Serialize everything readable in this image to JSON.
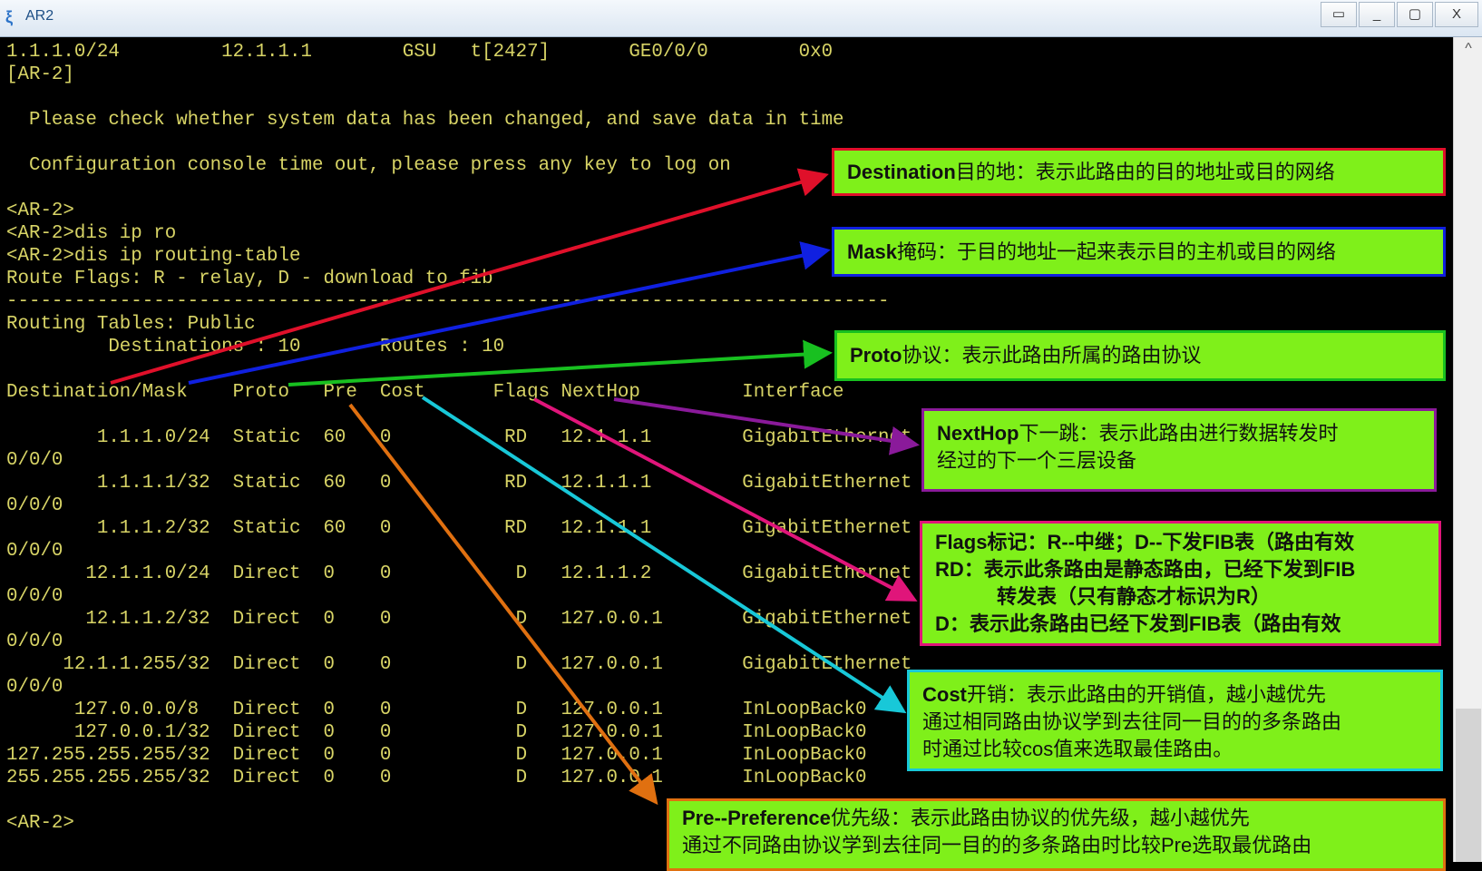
{
  "window": {
    "title": "AR2",
    "buttons": [
      "▭",
      "_",
      "▢",
      "X"
    ]
  },
  "terminal": {
    "lines": [
      "1.1.1.0/24         12.1.1.1        GSU   t[2427]       GE0/0/0        0x0",
      "[AR-2]",
      "",
      "  Please check whether system data has been changed, and save data in time",
      "",
      "  Configuration console time out, please press any key to log on",
      "",
      "<AR-2>",
      "<AR-2>dis ip ro",
      "<AR-2>dis ip routing-table",
      "Route Flags: R - relay, D - download to fib",
      "------------------------------------------------------------------------------",
      "Routing Tables: Public",
      "         Destinations : 10       Routes : 10",
      "",
      "Destination/Mask    Proto   Pre  Cost      Flags NextHop         Interface",
      "",
      "        1.1.1.0/24  Static  60   0          RD   12.1.1.1        GigabitEthernet",
      "0/0/0",
      "        1.1.1.1/32  Static  60   0          RD   12.1.1.1        GigabitEthernet",
      "0/0/0",
      "        1.1.1.2/32  Static  60   0          RD   12.1.1.1        GigabitEthernet",
      "0/0/0",
      "       12.1.1.0/24  Direct  0    0           D   12.1.1.2        GigabitEthernet",
      "0/0/0",
      "       12.1.1.2/32  Direct  0    0           D   127.0.0.1       GigabitEthernet",
      "0/0/0",
      "     12.1.1.255/32  Direct  0    0           D   127.0.0.1       GigabitEthernet",
      "0/0/0",
      "      127.0.0.0/8   Direct  0    0           D   127.0.0.1       InLoopBack0",
      "      127.0.0.1/32  Direct  0    0           D   127.0.0.1       InLoopBack0",
      "127.255.255.255/32  Direct  0    0           D   127.0.0.1       InLoopBack0",
      "255.255.255.255/32  Direct  0    0           D   127.0.0.1       InLoopBack0",
      "",
      "<AR-2>"
    ]
  },
  "annotations": {
    "destination": {
      "key": "Destination",
      "text": "目的地：表示此路由的目的地址或目的网络",
      "color": "#e0102a"
    },
    "mask": {
      "key": "Mask",
      "text": "掩码：于目的地址一起来表示目的主机或目的网络",
      "color": "#1020e0"
    },
    "proto": {
      "key": "Proto",
      "text": "协议：表示此路由所属的路由协议",
      "color": "#18c020"
    },
    "nexthop": {
      "key": "NextHop",
      "text1": "下一跳：表示此路由进行数据转发时",
      "text2": "经过的下一个三层设备",
      "color": "#8a1a9a"
    },
    "flags": {
      "l1": "Flags标记：R--中继；D--下发FIB表（路由有效",
      "l2": "RD：表示此条路由是静态路由，已经下发到FIB",
      "l3": "转发表（只有静态才标识为R）",
      "l4": "D：表示此条路由已经下发到FIB表（路由有效",
      "color": "#e0157a"
    },
    "cost": {
      "key": "Cost",
      "text1": "开销：表示此路由的开销值，越小越优先",
      "text2": "通过相同路由协议学到去往同一目的的多条路由",
      "text3": "时通过比较cos值来选取最佳路由。",
      "color": "#18c8d8"
    },
    "pre": {
      "key": "Pre--Preference",
      "text1": "优先级：表示此路由协议的优先级，越小越优先",
      "text2": "通过不同路由协议学到去往同一目的的多条路由时比较Pre选取最优路由",
      "color": "#e07010"
    }
  }
}
